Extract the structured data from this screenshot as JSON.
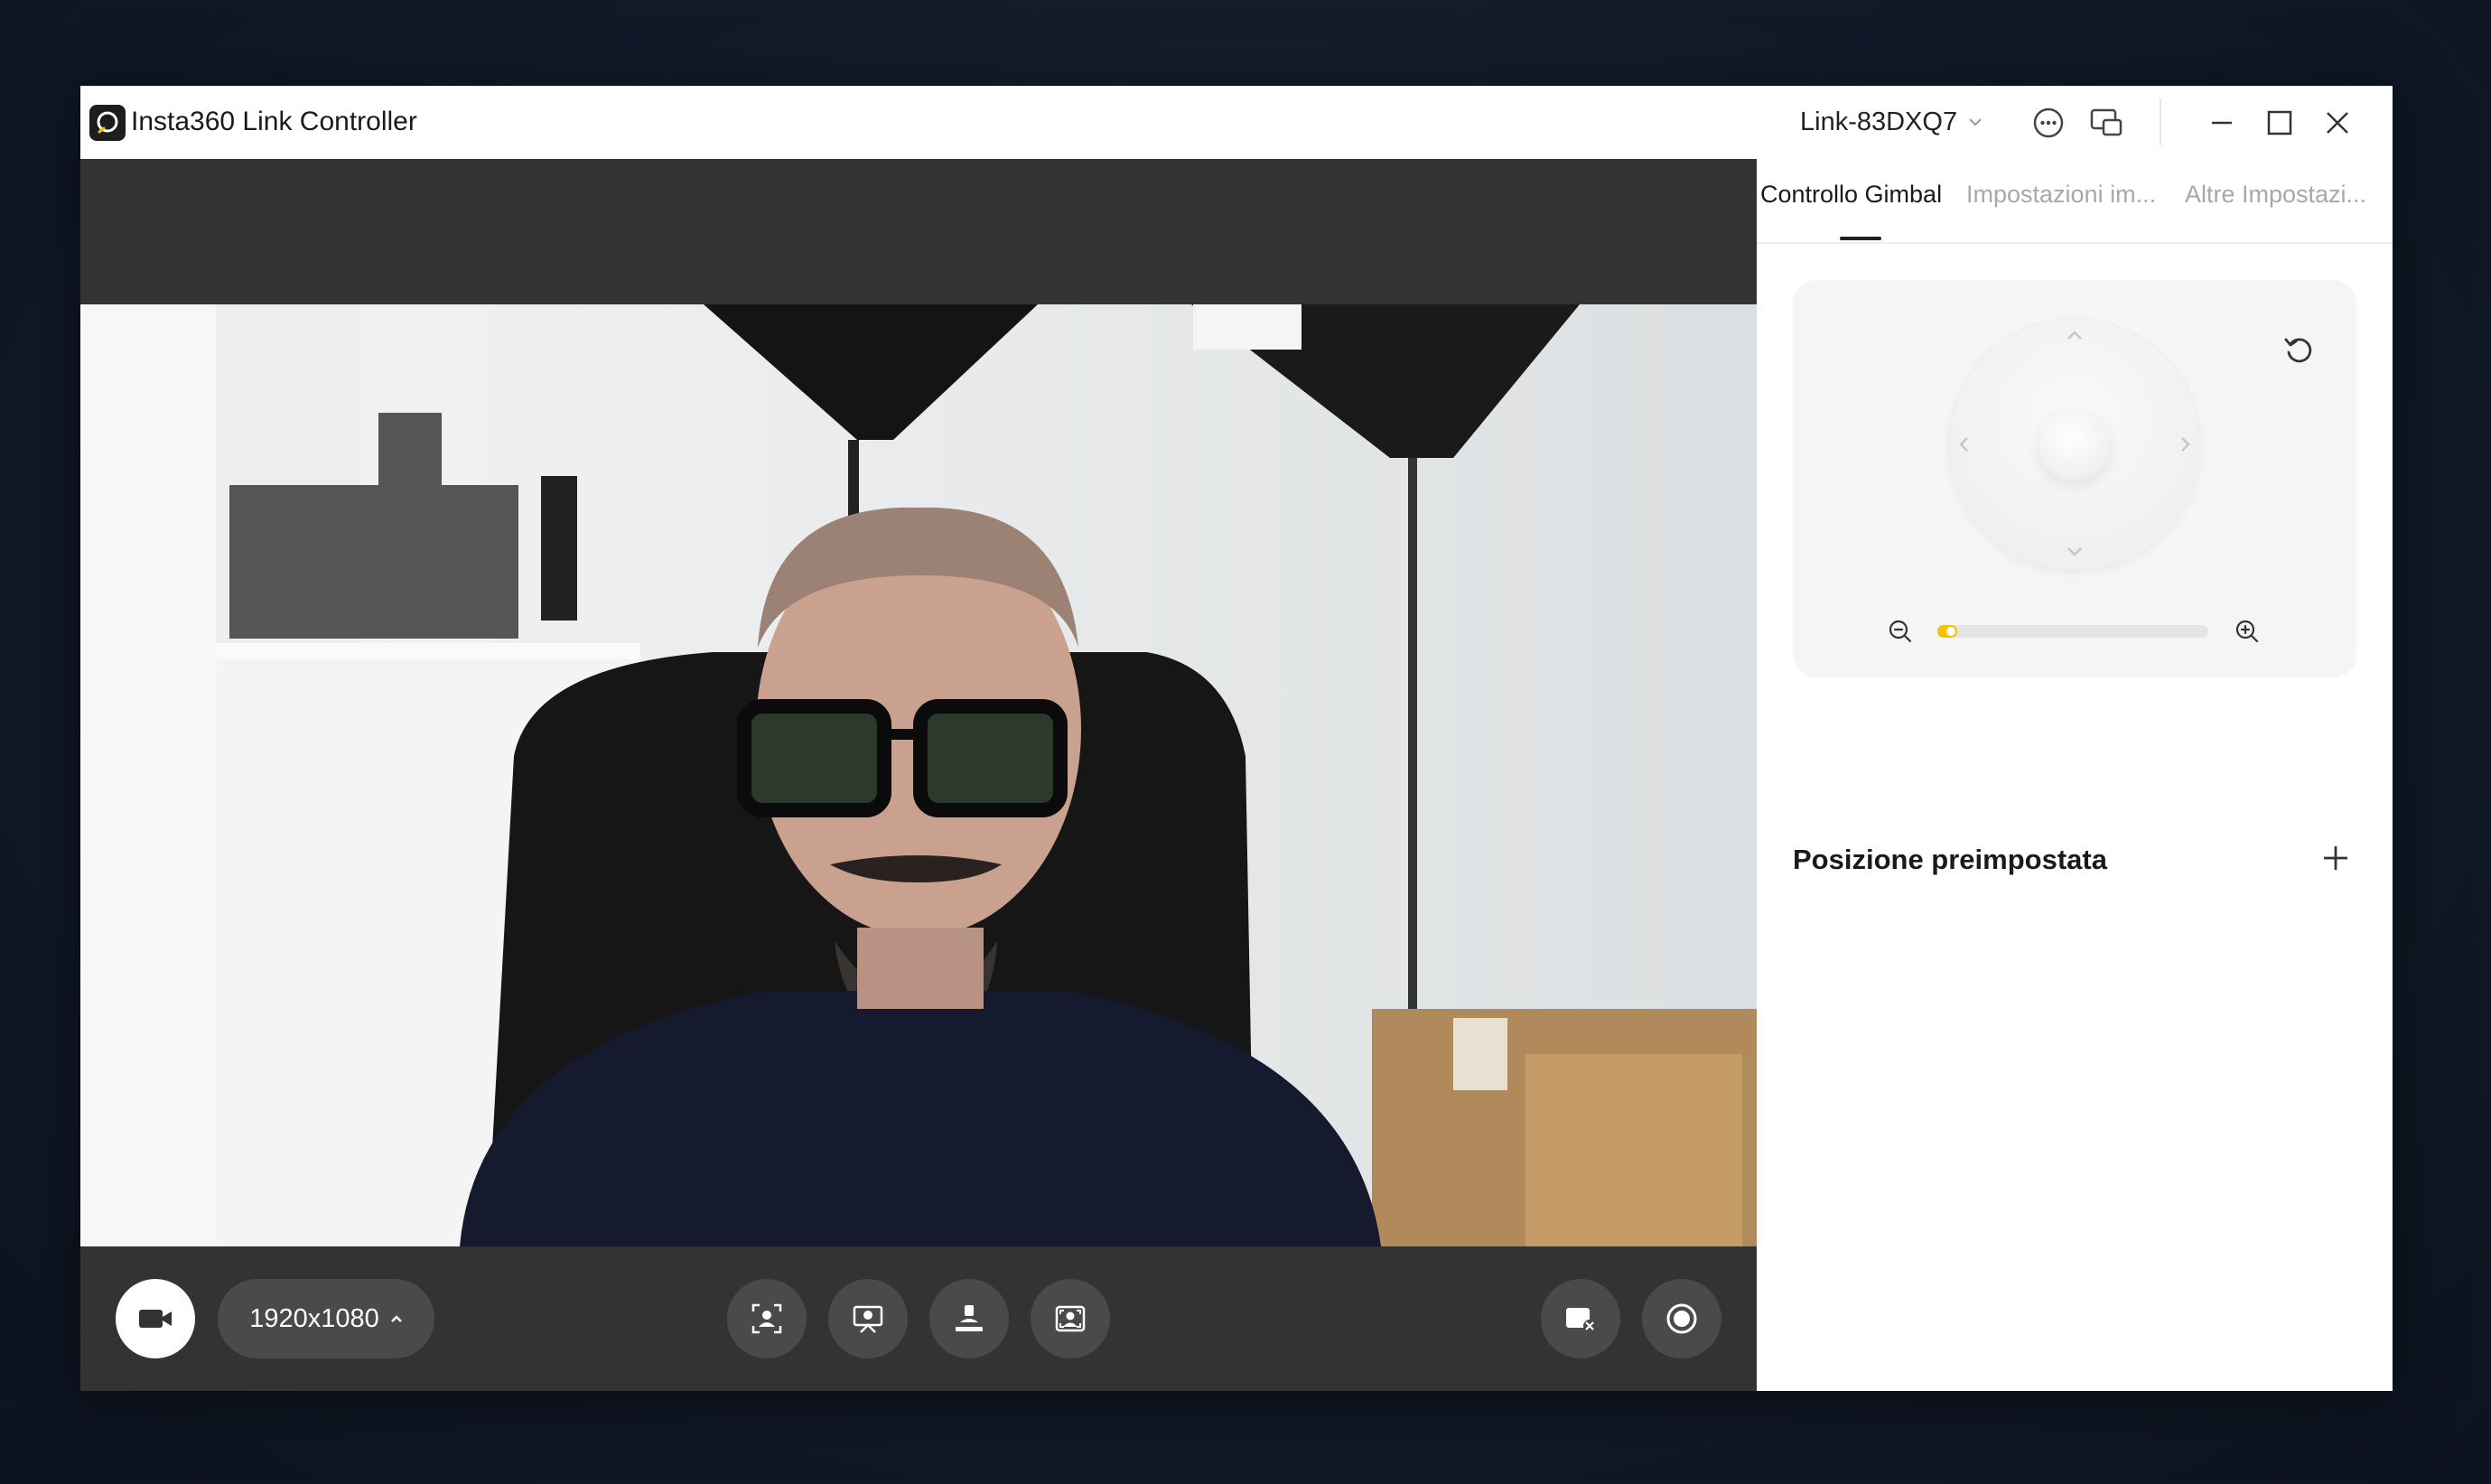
{
  "app": {
    "title": "Insta360 Link Controller",
    "device_name": "Link-83DXQ7"
  },
  "camera": {
    "resolution": "1920x1080"
  },
  "tabs": [
    {
      "label": "Controllo Gimbal",
      "active": true
    },
    {
      "label": "Impostazioni im...",
      "active": false
    },
    {
      "label": "Altre Impostazi...",
      "active": false
    }
  ],
  "gimbal": {
    "zoom_level": 0.05
  },
  "presets": {
    "title": "Posizione preimpostata"
  },
  "colors": {
    "accent": "#f5c400",
    "camera_bg": "#333333",
    "button_bg": "#4a4a4a"
  },
  "icons": {
    "video_button": "video-camera-icon",
    "tracking": "tracking-icon",
    "whiteboard": "whiteboard-icon",
    "desk_view": "desk-view-icon",
    "framing": "framing-icon",
    "virtual_camera": "virtual-camera-icon",
    "record": "record-icon"
  }
}
